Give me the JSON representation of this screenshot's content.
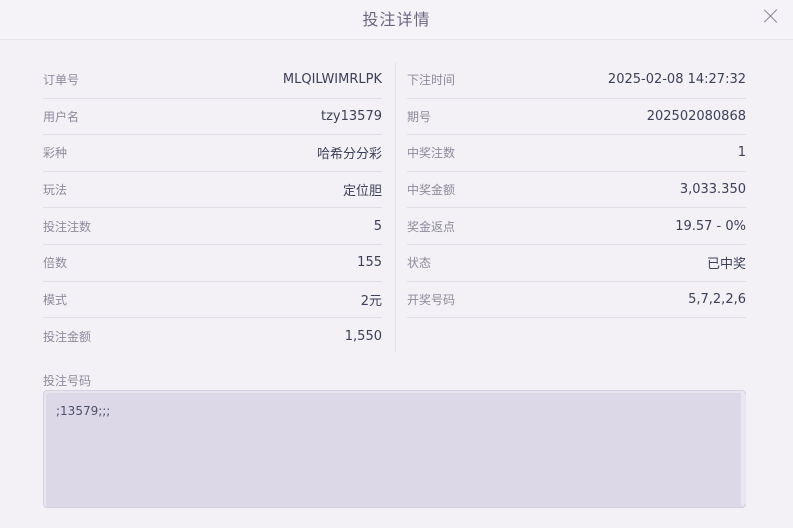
{
  "modal": {
    "title": "投注详情"
  },
  "left_rows": [
    {
      "label": "订单号",
      "value": "MLQILWIMRLPK"
    },
    {
      "label": "用户名",
      "value": "tzy13579"
    },
    {
      "label": "彩种",
      "value": "哈希分分彩"
    },
    {
      "label": "玩法",
      "value": "定位胆"
    },
    {
      "label": "投注注数",
      "value": "5"
    },
    {
      "label": "倍数",
      "value": "155"
    },
    {
      "label": "模式",
      "value": "2元"
    },
    {
      "label": "投注金额",
      "value": "1,550"
    }
  ],
  "right_rows": [
    {
      "label": "下注时间",
      "value": "2025-02-08 14:27:32"
    },
    {
      "label": "期号",
      "value": "202502080868"
    },
    {
      "label": "中奖注数",
      "value": "1"
    },
    {
      "label": "中奖金额",
      "value": "3,033.350"
    },
    {
      "label": "奖金返点",
      "value": "19.57 - 0%"
    },
    {
      "label": "状态",
      "value": "已中奖"
    },
    {
      "label": "开奖号码",
      "value": "5,7,2,2,6"
    }
  ],
  "bet_numbers": {
    "label": "投注号码",
    "value": ";13579;;;"
  }
}
